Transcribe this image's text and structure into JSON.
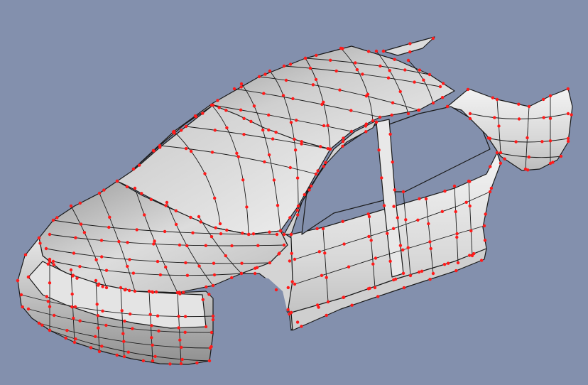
{
  "viewport": {
    "background_color": "#8390ad",
    "model_kind": "car-body-surface-mesh",
    "surface_color": "#d9d9d9",
    "edge_color": "#1a1a1a",
    "control_point_color": "#ff1a1a"
  }
}
